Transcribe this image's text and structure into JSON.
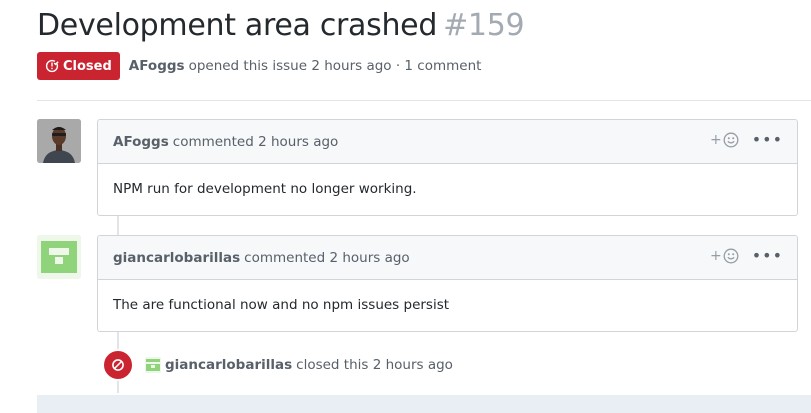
{
  "issue": {
    "title": "Development area crashed",
    "number": "#159",
    "state": "Closed",
    "author": "AFoggs",
    "opened_text": "opened this issue 2 hours ago · 1 comment"
  },
  "comments": [
    {
      "author": "AFoggs",
      "meta": "commented 2 hours ago",
      "body": "NPM run for development no longer working."
    },
    {
      "author": "giancarlobarillas",
      "meta": "commented 2 hours ago",
      "body": "The are functional now and no npm issues persist"
    }
  ],
  "event": {
    "author": "giancarlobarillas",
    "text": "closed this 2 hours ago"
  },
  "icons": {
    "state": "issue-closed-icon",
    "reaction": "smiley-icon",
    "more": "kebab-horizontal-icon",
    "event": "circle-slash-icon"
  },
  "colors": {
    "closed_red": "#cb2431",
    "identicon_green": "#8fd37a"
  }
}
